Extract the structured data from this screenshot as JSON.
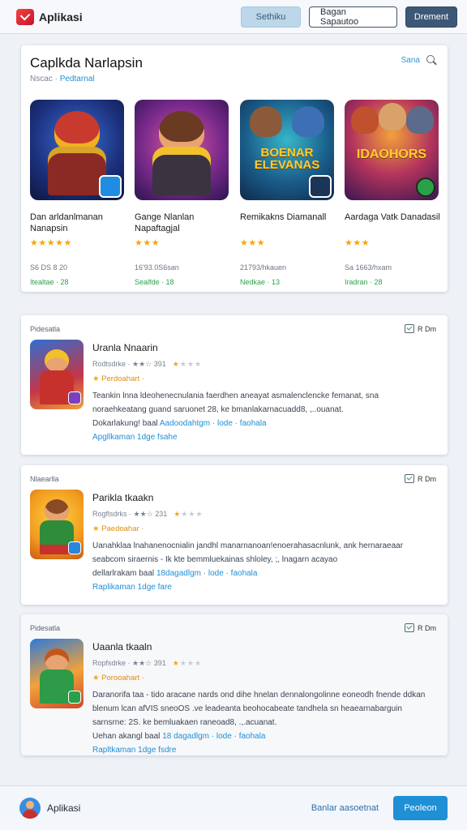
{
  "app": {
    "name": "Aplikasi"
  },
  "header": {
    "btn_soft": "Sethiku",
    "btn_outline": "Bagan Sapautoo",
    "btn_dark": "Drement"
  },
  "featured": {
    "title": "Caplkda Narlapsin",
    "subtitle_plain": "Nscac",
    "subtitle_accent": "Pedtarnal",
    "link": "Sana",
    "tiles": [
      {
        "name": "Dan arldanlmanan Nanapsin",
        "stars": "★★★★★",
        "meta": "S6 DS 8 20",
        "status": "Itealtae · 28"
      },
      {
        "name": "Gange Nlanlan Napaftagjal",
        "stars": "★★★",
        "meta": "16'93.0S6san",
        "status": "Sealfde · 18"
      },
      {
        "name": "Remikakns Diamanall",
        "stars": "★★★",
        "meta": "21793/hkauen",
        "status": "Nedkae · 13"
      },
      {
        "name": "Aardaga Vatk Danadasil",
        "stars": "★★★",
        "meta": "Sa 1663/hxam",
        "status": "Iradran · 28"
      }
    ],
    "tile_banners": [
      "",
      "",
      "BOENAR ELEVANAS",
      "IDAOHORS"
    ]
  },
  "reviews": [
    {
      "category": "Pidesatla",
      "corner": "R Dm",
      "title": "Uranla Nnaarin",
      "meta": "Rodtsdrke · ★★☆ 391",
      "badge": "Perdoahart ·",
      "body_1": "Teankin lnna ldeohenecnulania faerdhen aneayat asmalenclencke femanat, sna noraehkeatang guand saruonet 28, ke bmanlakarnacuadd8, ,..ouanat.",
      "body_2_plain": "Dokarlakung! baal",
      "body_2_link": "Aadoodahtgm · lode · faohala",
      "action": "Apgllkaman 1dge fsahe"
    },
    {
      "category": "Nlaearlla",
      "corner": "R Dm",
      "title": "Parikla tkaakn",
      "meta": "Rogflsdrks · ★★☆ 231",
      "badge": "Paedoahar ·",
      "body_1": "Uanahklaa lnahanenocnialin jandhl manarnanoan!enoerahasacnlunk, ank hernaraeaar seabcom siraernis - Ik kte bemmluekainas shloley, ;, lnagarn acayao",
      "body_2_plain": "dellarlrakam baal",
      "body_2_link": "18dagadlgm · lode · faohala",
      "action": "Raplikaman 1dge fare"
    },
    {
      "category": "Pidesatla",
      "corner": "R Dm",
      "title": "Uaanla tkaaln",
      "meta": "Ropfsdrke · ★★☆ 391",
      "badge": "Porooahart ·",
      "body_1": "Daranorifa taa - tido aracane nards ond dihe hnelan dennalongolinne eoneodh fnende ddkan blenum lcan afVIS sneoOS .ve leadeanta beohocabeate tandhela sn heaearnabarguin sarnsrne: 2S. ke bemluakaen raneoad8, .,.acuanat.",
      "body_2_plain": "Uehan akangl baal",
      "body_2_link": "18 dagadlgm · lode · faohala",
      "action": "Rapltkaman 1dge fsdre"
    }
  ],
  "bottom": {
    "name": "Aplikasi",
    "link": "Banlar aasoetnat",
    "button": "Peoleon"
  }
}
